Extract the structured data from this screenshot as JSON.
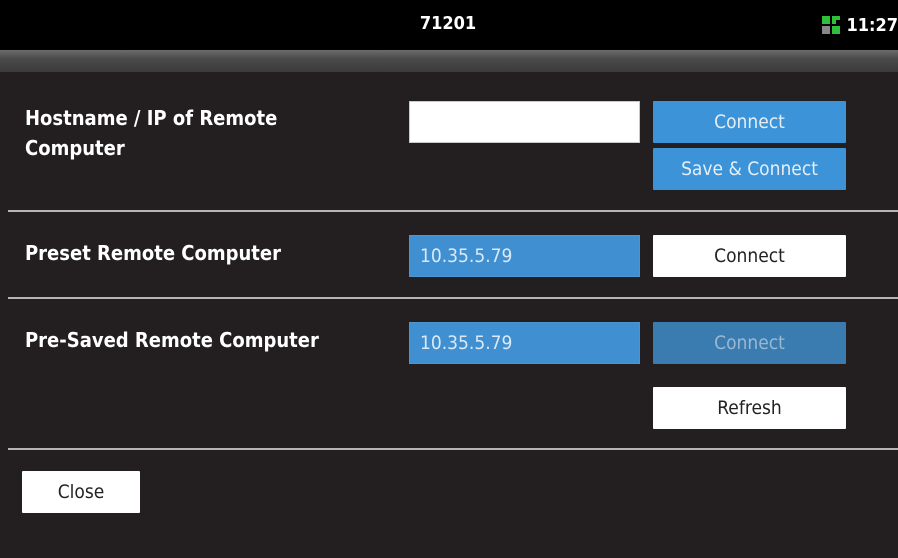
{
  "statusbar": {
    "title": "71201",
    "time": "11:27",
    "icon": "network-icon"
  },
  "sections": [
    {
      "label": "Hostname / IP of Remote Computer",
      "input_value": "",
      "buttons": [
        "Connect",
        "Save & Connect"
      ]
    },
    {
      "label": "Preset Remote Computer",
      "input_value": "10.35.5.79",
      "buttons": [
        "Connect"
      ]
    },
    {
      "label": "Pre-Saved Remote Computer",
      "input_value": "10.35.5.79",
      "buttons": [
        "Connect",
        "Refresh"
      ]
    }
  ],
  "close_label": "Close",
  "colors": {
    "background": "#231f20",
    "statusbar": "#000000",
    "accent_blue": "#3d93d8",
    "disabled_blue": "#3b7cb0",
    "icon_green": "#2fbf3a"
  }
}
